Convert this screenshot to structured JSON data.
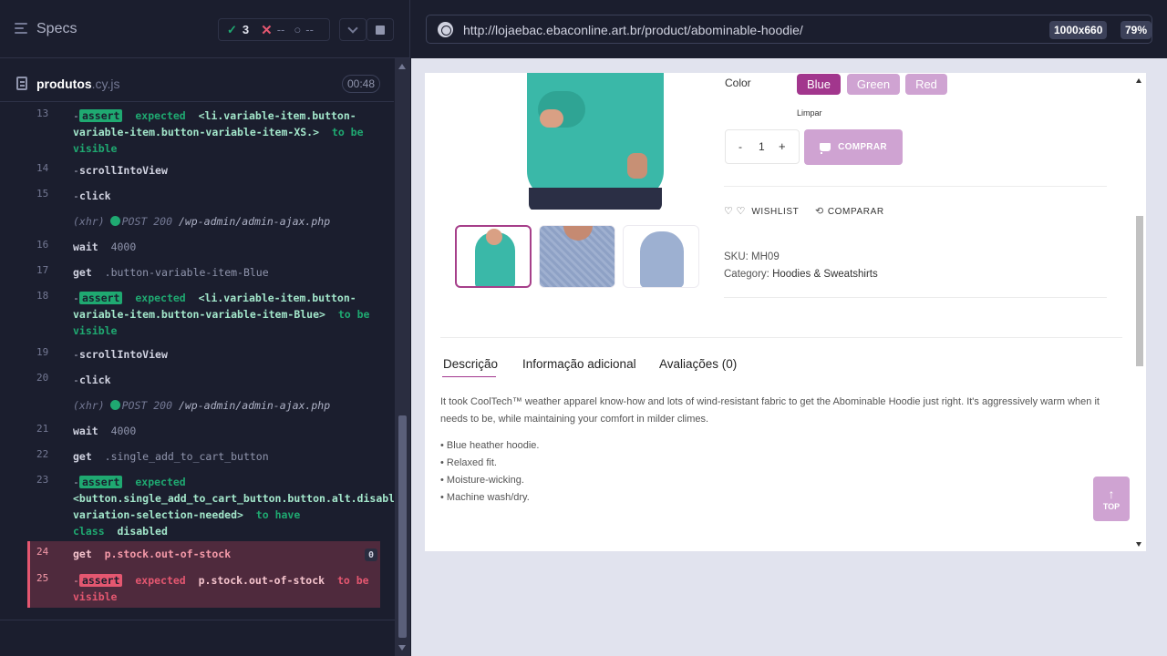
{
  "reporter": {
    "specs_label": "Specs",
    "stats": {
      "passed": "3",
      "failed": "--",
      "pending": "--"
    },
    "file": {
      "name": "produtos",
      "ext": ".cy.js",
      "duration": "00:48"
    },
    "commands": [
      {
        "num": "13",
        "type": "assert",
        "badge": "assert",
        "expected": "expected",
        "selector": "<li.variable-item.button-variable-item.button-variable-item-XS.>",
        "tail": "to be visible"
      },
      {
        "num": "14",
        "type": "child",
        "name": "scrollIntoView"
      },
      {
        "num": "15",
        "type": "child",
        "name": "click"
      },
      {
        "type": "xhr",
        "label": "(xhr)",
        "status": "POST 200",
        "route": "/wp-admin/admin-ajax.php"
      },
      {
        "num": "16",
        "type": "cmd",
        "name": "wait",
        "arg": "4000"
      },
      {
        "num": "17",
        "type": "cmd",
        "name": "get",
        "arg": ".button-variable-item-Blue"
      },
      {
        "num": "18",
        "type": "assert",
        "badge": "assert",
        "expected": "expected",
        "selector": "<li.variable-item.button-variable-item.button-variable-item-Blue>",
        "tail": "to be visible"
      },
      {
        "num": "19",
        "type": "child",
        "name": "scrollIntoView"
      },
      {
        "num": "20",
        "type": "child",
        "name": "click"
      },
      {
        "type": "xhr",
        "label": "(xhr)",
        "status": "POST 200",
        "route": "/wp-admin/admin-ajax.php"
      },
      {
        "num": "21",
        "type": "cmd",
        "name": "wait",
        "arg": "4000"
      },
      {
        "num": "22",
        "type": "cmd",
        "name": "get",
        "arg": ".single_add_to_cart_button"
      },
      {
        "num": "23",
        "type": "assert",
        "badge": "assert",
        "expected": "expected",
        "selector": "<button.single_add_to_cart_button.button.alt.disabled.wc-variation-selection-needed>",
        "tail": "to have class",
        "value": "disabled"
      },
      {
        "num": "24",
        "type": "fail-get",
        "name": "get",
        "arg": "p.stock.out-of-stock",
        "count": "0"
      },
      {
        "num": "25",
        "type": "fail-assert",
        "badge": "assert",
        "expected": "expected",
        "selector": "p.stock.out-of-stock",
        "tail": "to be visible"
      }
    ]
  },
  "browser": {
    "url": "http://lojaebac.ebaconline.art.br/product/abominable-hoodie/",
    "viewport": "1000x660",
    "zoom": "79%"
  },
  "product": {
    "color_label": "Color",
    "swatches": [
      "Blue",
      "Green",
      "Red"
    ],
    "selected_swatch": "Blue",
    "clear_label": "Limpar",
    "qty_minus": "-",
    "qty_value": "1",
    "qty_plus": "+",
    "buy_label": "COMPRAR",
    "wishlist_label": "WISHLIST",
    "compare_label": "COMPARAR",
    "sku_label": "SKU:",
    "sku_value": "MH09",
    "category_label": "Category:",
    "category_value": "Hoodies & Sweatshirts",
    "tabs": [
      "Descrição",
      "Informação adicional",
      "Avaliações (0)"
    ],
    "description": "It took CoolTech™ weather apparel know-how and lots of wind-resistant fabric to get the Abominable Hoodie just right. It's aggressively warm when it needs to be, while maintaining your comfort in milder climes.",
    "bullets": [
      "• Blue heather hoodie.",
      "• Relaxed fit.",
      "• Moisture-wicking.",
      "• Machine wash/dry."
    ],
    "top_label": "TOP"
  },
  "colors": {
    "pass": "#1fa971",
    "fail": "#e45770",
    "accent": "#a2368d",
    "swatch_inactive": "#cfa3d2"
  }
}
